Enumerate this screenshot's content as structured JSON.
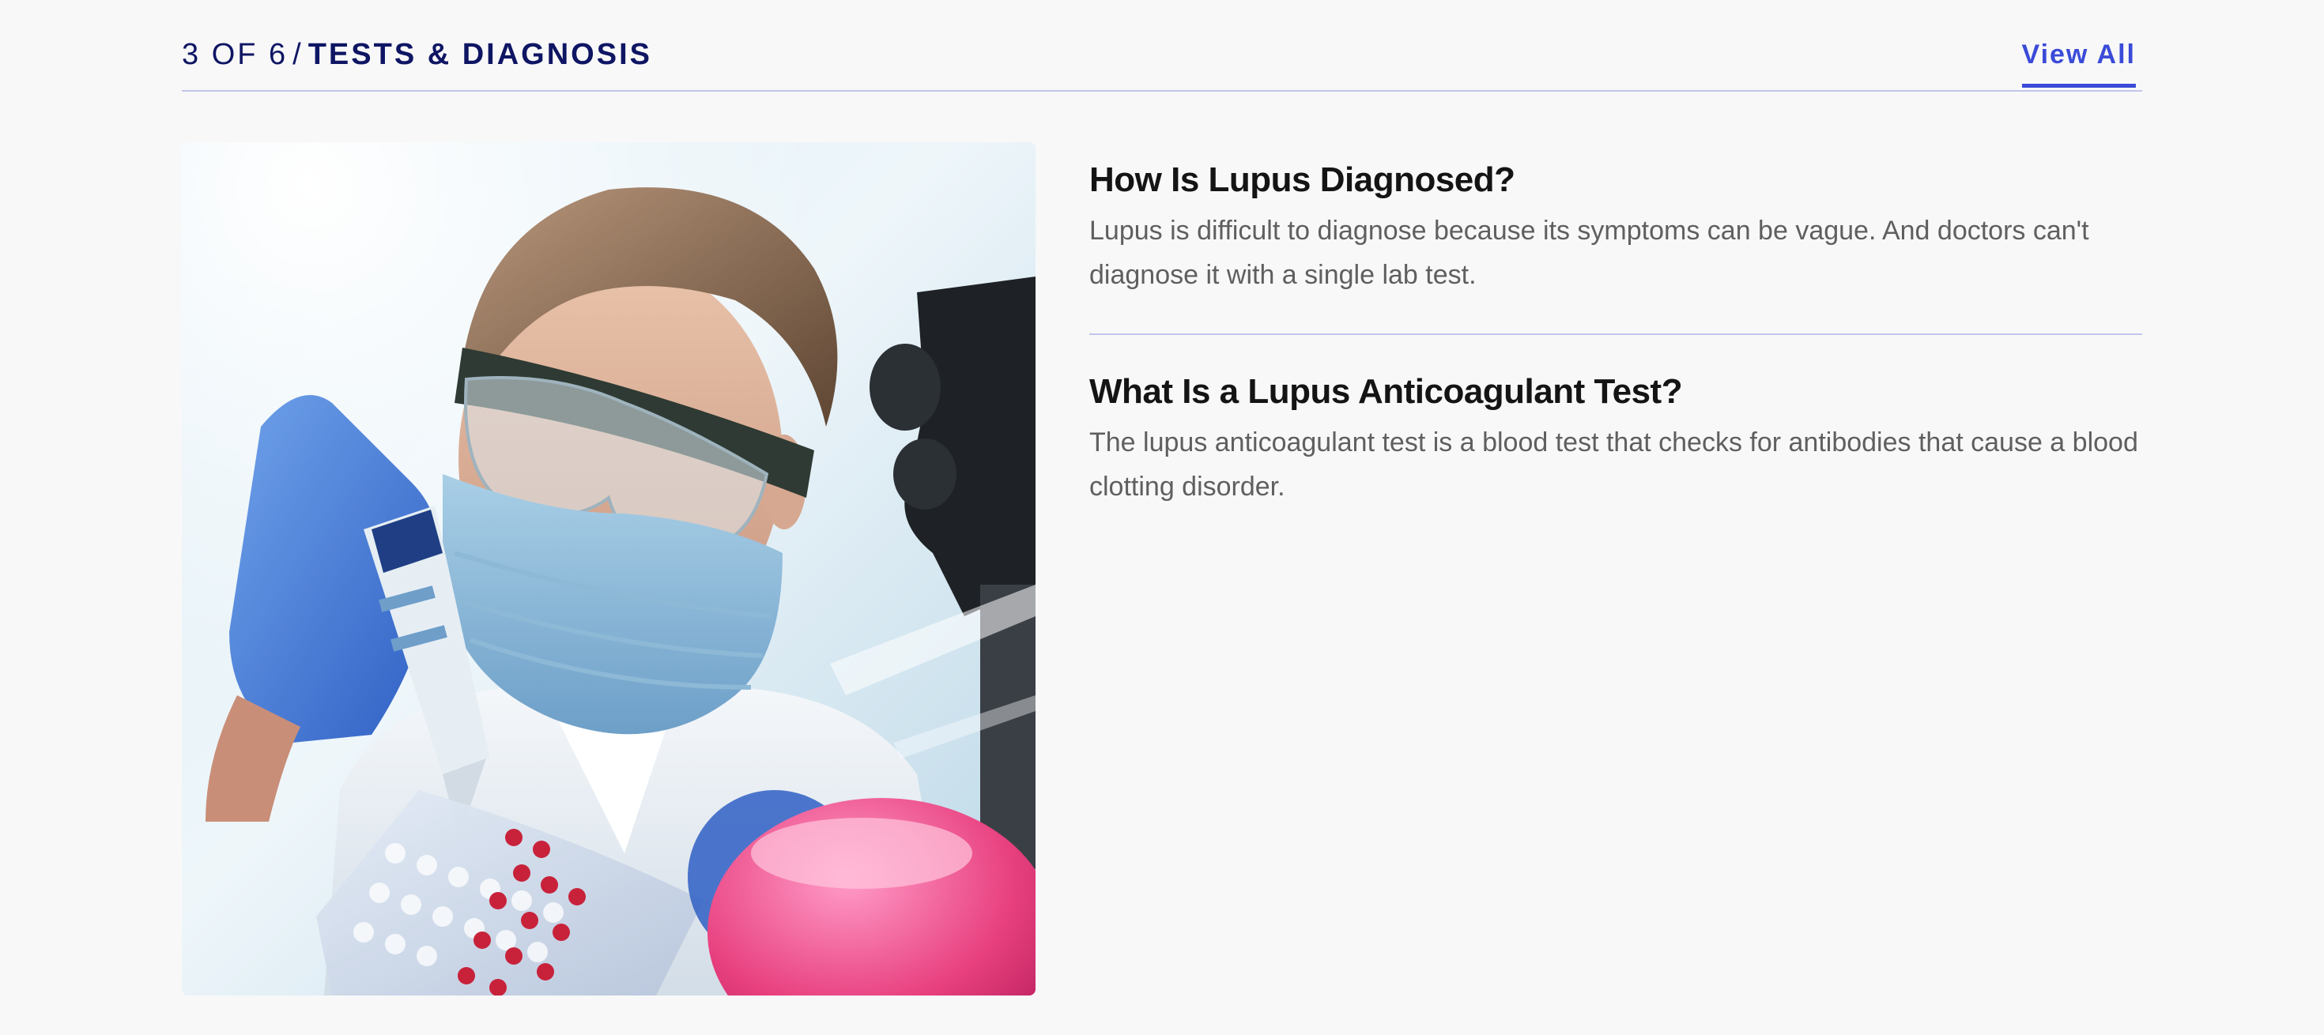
{
  "header": {
    "counter": "3 OF 6",
    "separator": "/",
    "topic": "Tests & Diagnosis",
    "view_all_label": "View All"
  },
  "hero_image": {
    "alt": "Lab technician in goggles and mask pipetting samples",
    "icon": "lab-photo"
  },
  "articles": [
    {
      "title": "How Is Lupus Diagnosed?",
      "description": "Lupus is difficult to diagnose because its symptoms can be vague. And doctors can't diagnose it with a single lab test."
    },
    {
      "title": "What Is a Lupus Anticoagulant Test?",
      "description": "The lupus anticoagulant test is a blood test that checks for antibodies that cause a blood clotting disorder."
    }
  ],
  "colors": {
    "accent": "#3a4bd8",
    "navy": "#0e1663",
    "divider": "#c3c6ea",
    "background": "#f8f8f9"
  }
}
